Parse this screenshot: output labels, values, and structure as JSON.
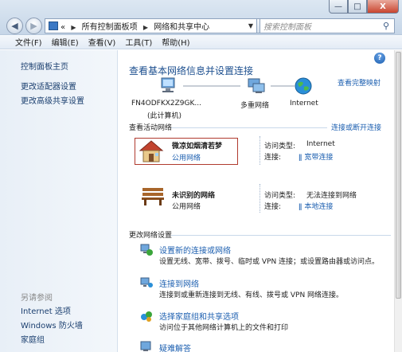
{
  "window": {
    "title": "",
    "min_label": "—",
    "max_label": "□",
    "close_label": "X"
  },
  "nav": {
    "breadcrumb_prefix": "«",
    "breadcrumbs": [
      "所有控制面板项",
      "网络和共享中心"
    ],
    "search_placeholder": "搜索控制面板"
  },
  "menu": [
    "文件(F)",
    "编辑(E)",
    "查看(V)",
    "工具(T)",
    "帮助(H)"
  ],
  "sidebar": {
    "links": [
      "控制面板主页",
      "更改适配器设置",
      "更改高级共享设置"
    ],
    "see_also_header": "另请参阅",
    "see_also": [
      "Internet 选项",
      "Windows 防火墙",
      "家庭组"
    ]
  },
  "main": {
    "heading": "查看基本网络信息并设置连接",
    "full_map_link": "查看完整映射",
    "map": {
      "computer_name": "FN4ODFKX2Z9GK...",
      "computer_sub": "(此计算机)",
      "middle": "多重网络",
      "internet": "Internet"
    },
    "active_networks_label": "查看活动网络",
    "connect_disconnect_link": "连接或断开连接",
    "networks": [
      {
        "name": "微凉如烟清若梦",
        "type": "公用网络",
        "access_label": "访问类型:",
        "access_value": "Internet",
        "conn_label": "连接:",
        "conn_value": "宽带连接"
      },
      {
        "name": "未识别的网络",
        "type": "公用网络",
        "access_label": "访问类型:",
        "access_value": "无法连接到网络",
        "conn_label": "连接:",
        "conn_value": "本地连接"
      }
    ],
    "change_settings_label": "更改网络设置",
    "tasks": [
      {
        "title": "设置新的连接或网络",
        "desc": "设置无线、宽带、拨号、临时或 VPN 连接；或设置路由器或访问点。"
      },
      {
        "title": "连接到网络",
        "desc": "连接到或重新连接到无线、有线、拨号或 VPN 网络连接。"
      },
      {
        "title": "选择家庭组和共享选项",
        "desc": "访问位于其他网络计算机上的文件和打印"
      },
      {
        "title": "疑难解答",
        "desc": ""
      }
    ]
  },
  "colors": {
    "link": "#1c5fb0",
    "heading": "#1c4f8f",
    "highlight_box": "#b03a2e"
  }
}
